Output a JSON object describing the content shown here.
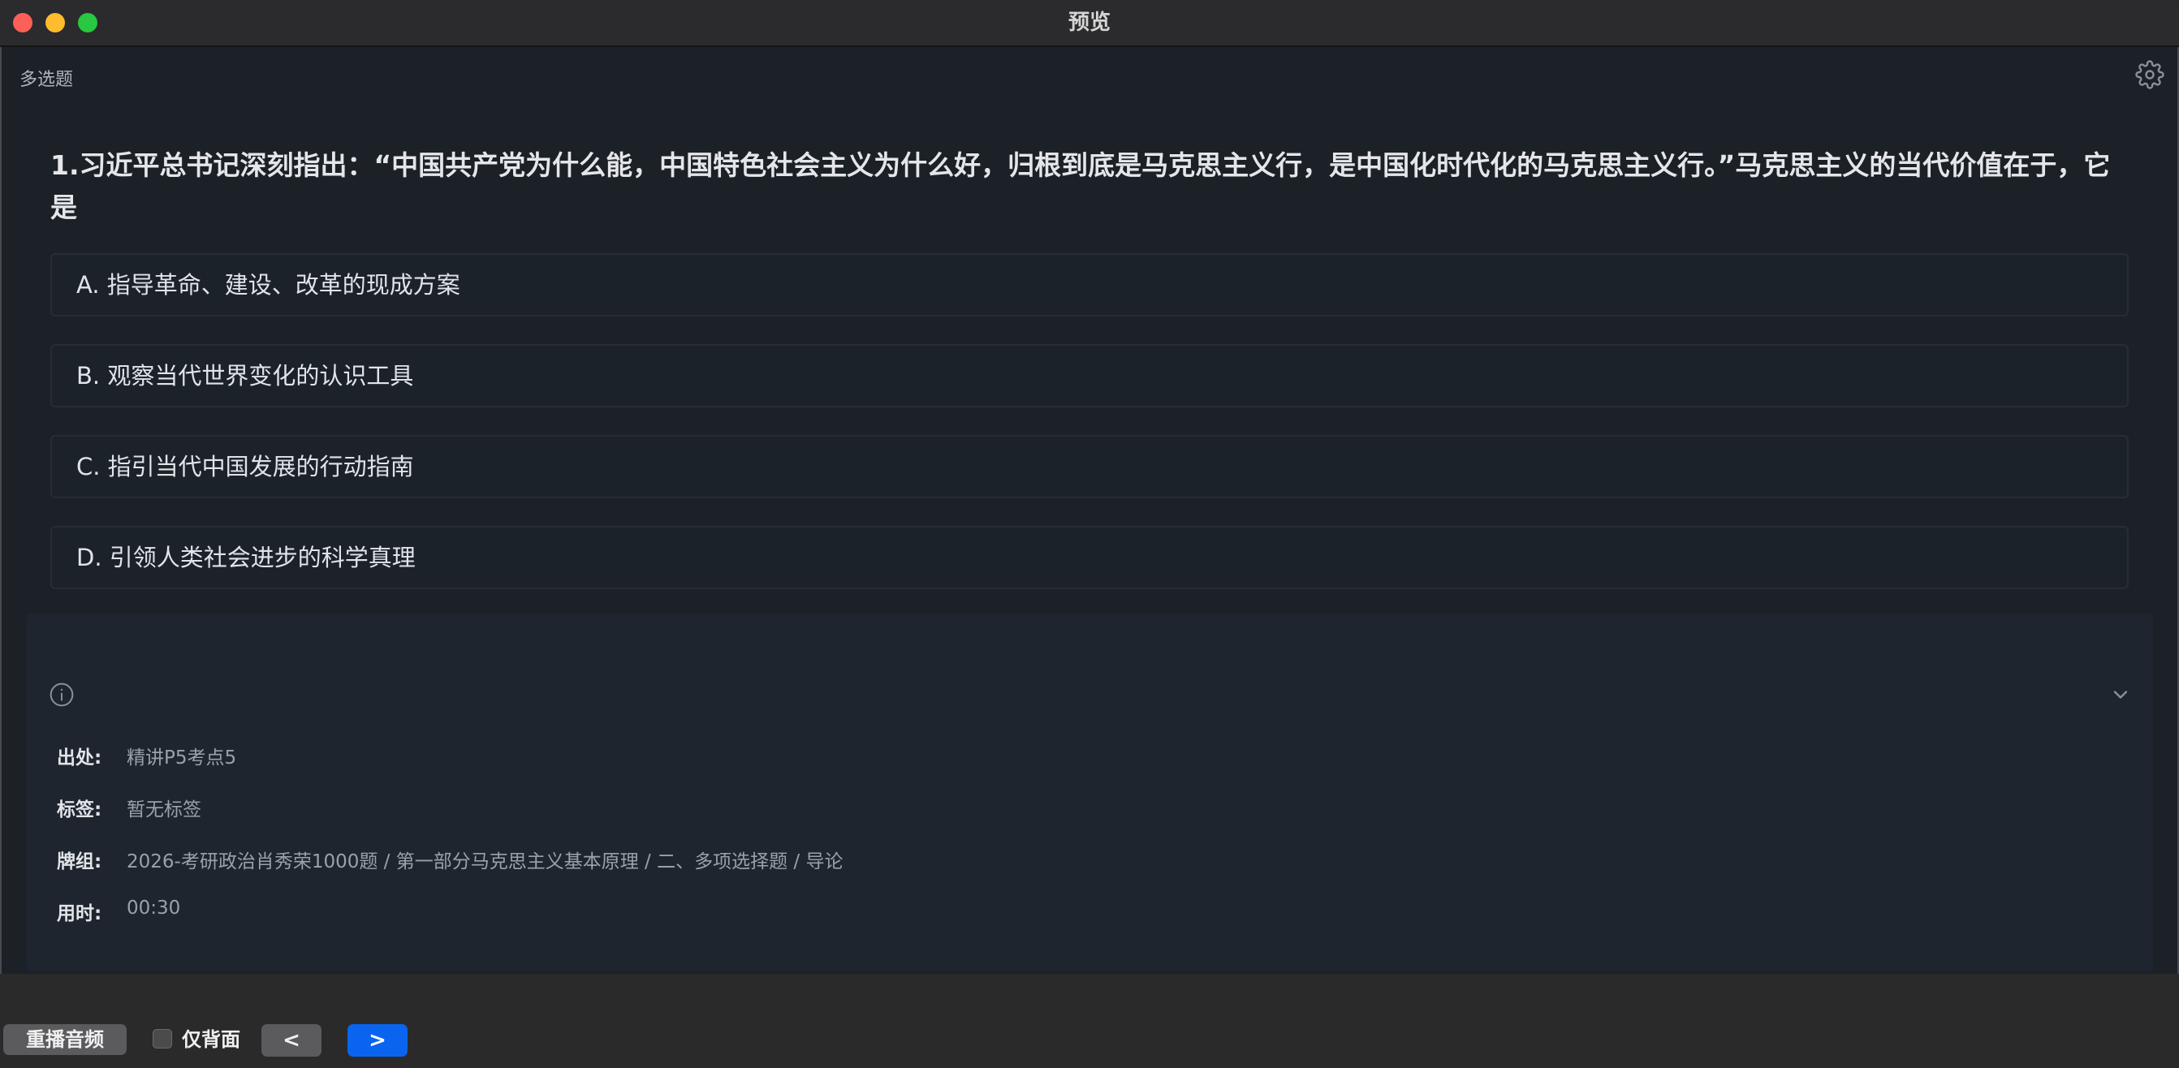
{
  "window": {
    "title": "预览"
  },
  "header": {
    "question_type": "多选题",
    "settings_icon": "gear-icon"
  },
  "question": {
    "text": "1.习近平总书记深刻指出：“中国共产党为什么能，中国特色社会主义为什么好，归根到底是马克思主义行，是中国化时代化的马克思主义行。”马克思主义的当代价值在于，它是",
    "options": [
      {
        "label": "A. 指导革命、建设、改革的现成方案"
      },
      {
        "label": "B. 观察当代世界变化的认识工具"
      },
      {
        "label": "C. 指引当代中国发展的行动指南"
      },
      {
        "label": "D. 引领人类社会进步的科学真理"
      }
    ]
  },
  "info": {
    "icons": {
      "info": "info-icon",
      "collapse": "chevron-down-icon"
    },
    "source_label": "出处:",
    "source_value": "精讲P5考点5",
    "tags_label": "标签:",
    "tags_value": "暂无标签",
    "deck_label": "牌组:",
    "deck_value": "2026-考研政治肖秀荣1000题 / 第一部分马克思主义基本原理 / 二、多项选择题 / 导论",
    "time_label": "用时:",
    "time_value": "00:30"
  },
  "toolbar": {
    "replay_label": "重播音频",
    "back_only_label": "仅背面",
    "back_only_checked": false,
    "prev_label": "<",
    "next_label": ">"
  },
  "colors": {
    "accent": "#0a64f0",
    "background": "#1c2128",
    "close": "#fe5f57",
    "minimize": "#febc2e",
    "maximize": "#28c840"
  }
}
